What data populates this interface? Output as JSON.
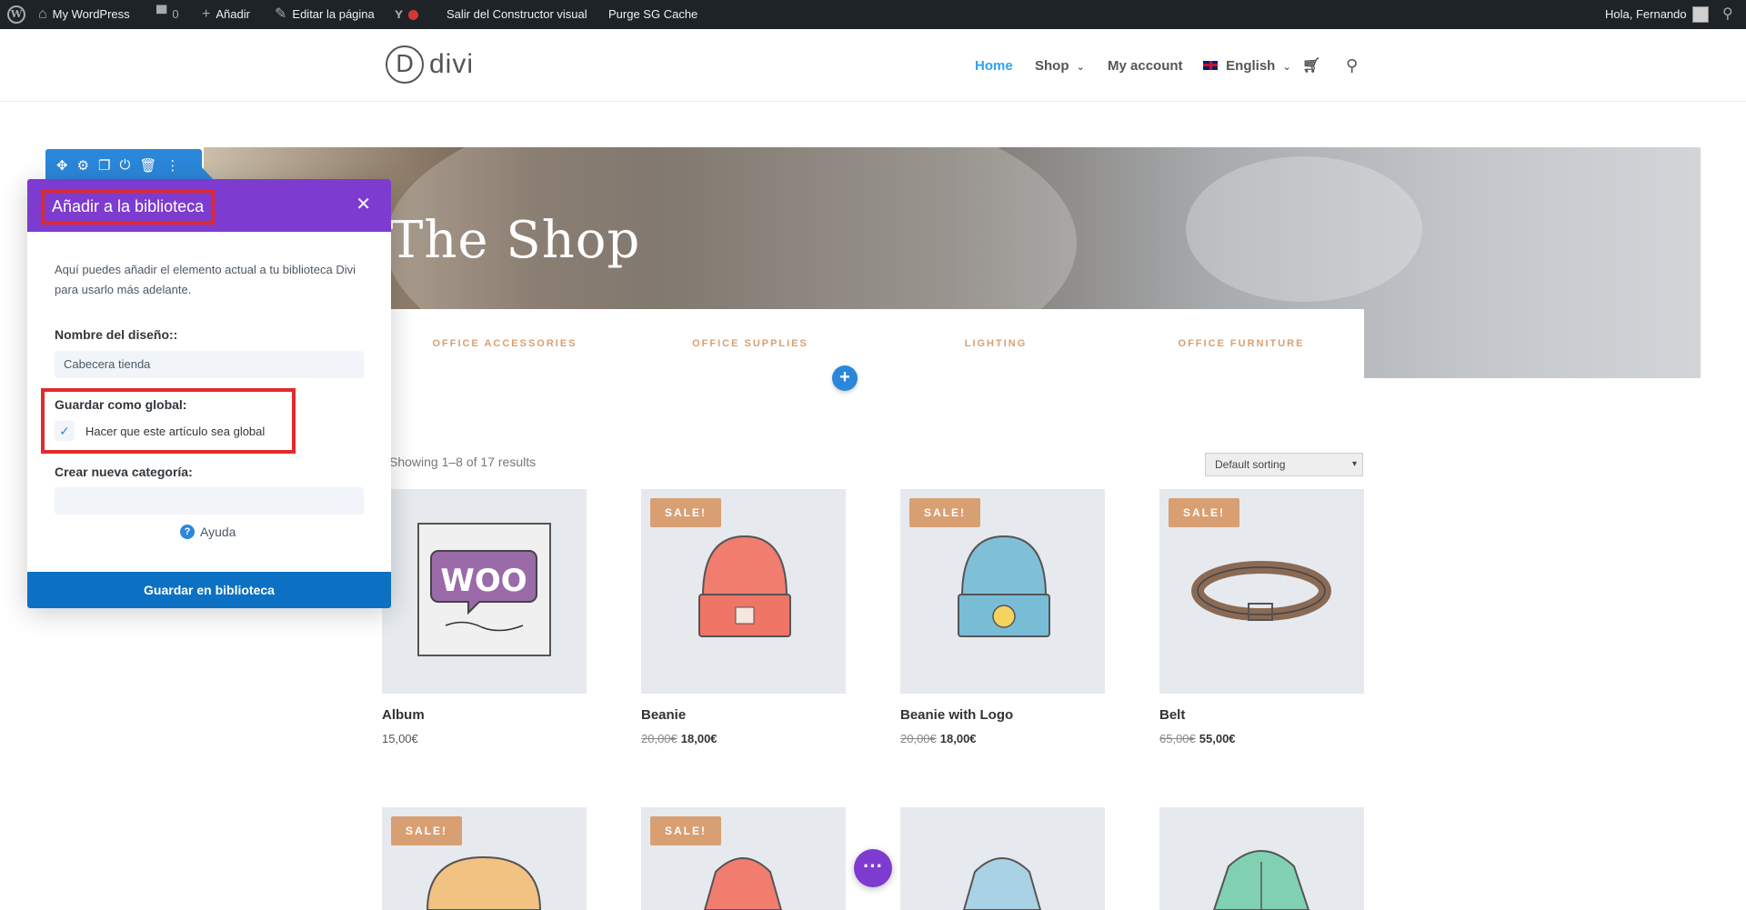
{
  "admin_bar": {
    "site_name": "My WordPress",
    "comments_count": "0",
    "new_label": "Añadir",
    "edit_page_label": "Editar la página",
    "exit_builder_label": "Salir del Constructor visual",
    "purge_cache_label": "Purge SG Cache",
    "greeting": "Hola, Fernando"
  },
  "header": {
    "logo_letter": "D",
    "logo_text": "divi",
    "nav": [
      "Home",
      "Shop",
      "My account",
      "English"
    ],
    "language_chevron": "⌄"
  },
  "hero": {
    "title": "The Shop",
    "categories": [
      "OFFICE ACCESSORIES",
      "OFFICE SUPPLIES",
      "LIGHTING",
      "OFFICE FURNITURE"
    ]
  },
  "shop": {
    "results_text": "Showing 1–8 of 17 results",
    "sorting_value": "Default sorting",
    "sale_label": "SALE!",
    "products": [
      {
        "name": "Album",
        "price": "15,00€",
        "old_price": "",
        "sale": false
      },
      {
        "name": "Beanie",
        "price": "18,00€",
        "old_price": "20,00€",
        "sale": true
      },
      {
        "name": "Beanie with Logo",
        "price": "18,00€",
        "old_price": "20,00€",
        "sale": true
      },
      {
        "name": "Belt",
        "price": "55,00€",
        "old_price": "65,00€",
        "sale": true
      }
    ]
  },
  "library_modal": {
    "title": "Añadir a la biblioteca",
    "description": "Aquí puedes añadir el elemento actual a tu biblioteca Divi para usarlo más adelante.",
    "layout_name_label": "Nombre del diseño::",
    "layout_name_value": "Cabecera tienda",
    "save_global_label": "Guardar como global:",
    "make_global_label": "Hacer que este artículo sea global",
    "new_category_label": "Crear nueva categoría:",
    "new_category_value": "",
    "help_label": "Ayuda",
    "save_button": "Guardar en biblioteca"
  },
  "colors": {
    "admin_bar": "#1d2327",
    "divi_purple": "#7e3bd0",
    "divi_blue": "#2b87da",
    "highlight_red": "#e02b2b",
    "accent_tan": "#d89f73",
    "link_blue": "#2ea3f2"
  }
}
